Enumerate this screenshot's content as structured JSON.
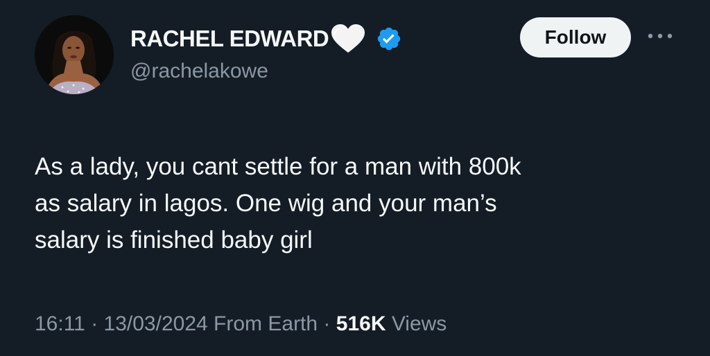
{
  "tweet": {
    "author": {
      "display_name": "RACHEL EDWARD",
      "handle": "@rachelakowe",
      "name_emoji": "white-heart-icon",
      "verified": true
    },
    "follow_label": "Follow",
    "text": "As a lady, you cant settle for a man with 800k\nas salary in lagos. One wig and your man’s\nsalary is finished baby girl",
    "time": "16:11",
    "date": "13/03/2024",
    "source": "From Earth",
    "separator": "·",
    "views_count": "516K",
    "views_label": "Views"
  },
  "colors": {
    "background": "#141d26",
    "text_primary": "#f7f9f9",
    "text_secondary": "#8b98a5",
    "verified_blue": "#1d9bf0",
    "follow_bg": "#eff3f4",
    "follow_text": "#0f1419"
  }
}
